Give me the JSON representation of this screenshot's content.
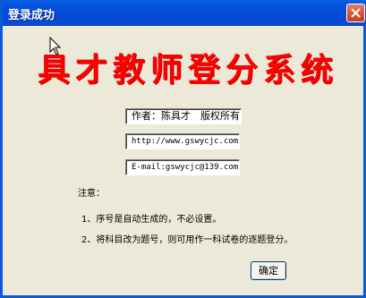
{
  "window": {
    "title": "登录成功"
  },
  "banner": {
    "text": "具才教师登分系统"
  },
  "fields": {
    "author": "作者：陈具才　版权所有",
    "url": "http://www.gswycjc.com",
    "email": "E-mail:gswycjc@139.com"
  },
  "notes": {
    "heading": "注意：",
    "item1": "1、序号是自动生成的，不必设置。",
    "item2": "2、将科目改为题号，则可用作一科试卷的逐题登分。"
  },
  "buttons": {
    "ok": "确定"
  },
  "colors": {
    "banner": "#ff0000",
    "titlebar": "#0349d3",
    "close": "#c8391c"
  },
  "icons": {
    "close": "close-icon",
    "cursor": "mouse-cursor-icon"
  }
}
